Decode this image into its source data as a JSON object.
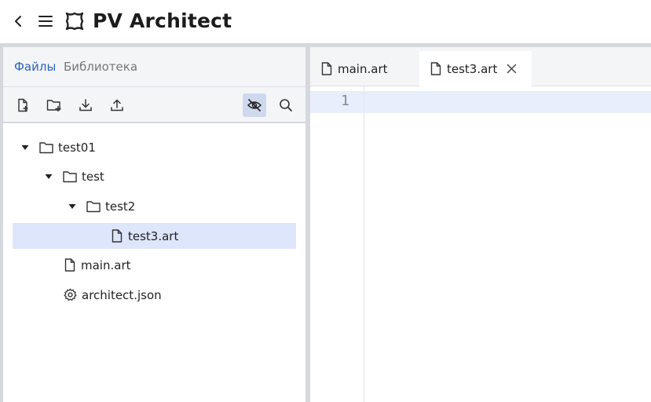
{
  "header": {
    "title": "PV Architect",
    "back_icon": "chevron-left-icon",
    "menu_icon": "hamburger-menu-icon",
    "logo_icon": "puzzle-logo-icon"
  },
  "left_panel": {
    "tabs": [
      {
        "label": "Файлы",
        "active": true
      },
      {
        "label": "Библиотека",
        "active": false
      }
    ],
    "toolbar": [
      {
        "icon": "new-file-icon",
        "active": false
      },
      {
        "icon": "new-folder-icon",
        "active": false
      },
      {
        "icon": "download-icon",
        "active": false
      },
      {
        "icon": "upload-icon",
        "active": false
      },
      {
        "icon": "eye-off-icon",
        "active": true
      },
      {
        "icon": "search-icon",
        "active": false
      }
    ],
    "tree": [
      {
        "label": "test01",
        "type": "folder",
        "expanded": true,
        "depth": 0
      },
      {
        "label": "test",
        "type": "folder",
        "expanded": true,
        "depth": 1
      },
      {
        "label": "test2",
        "type": "folder",
        "expanded": true,
        "depth": 2
      },
      {
        "label": "test3.art",
        "type": "file",
        "selected": true,
        "depth": 3
      },
      {
        "label": "main.art",
        "type": "file",
        "depth": 1
      },
      {
        "label": "architect.json",
        "type": "settings",
        "depth": 1
      }
    ]
  },
  "editor": {
    "tabs": [
      {
        "label": "main.art",
        "active": false
      },
      {
        "label": "test3.art",
        "active": true,
        "closable": true
      }
    ],
    "line_numbers": [
      "1"
    ]
  },
  "colors": {
    "accent": "#2c64b8",
    "selection": "#dde6fb",
    "divider": "#d5d8dc",
    "panel_bg": "#f4f5f7"
  }
}
